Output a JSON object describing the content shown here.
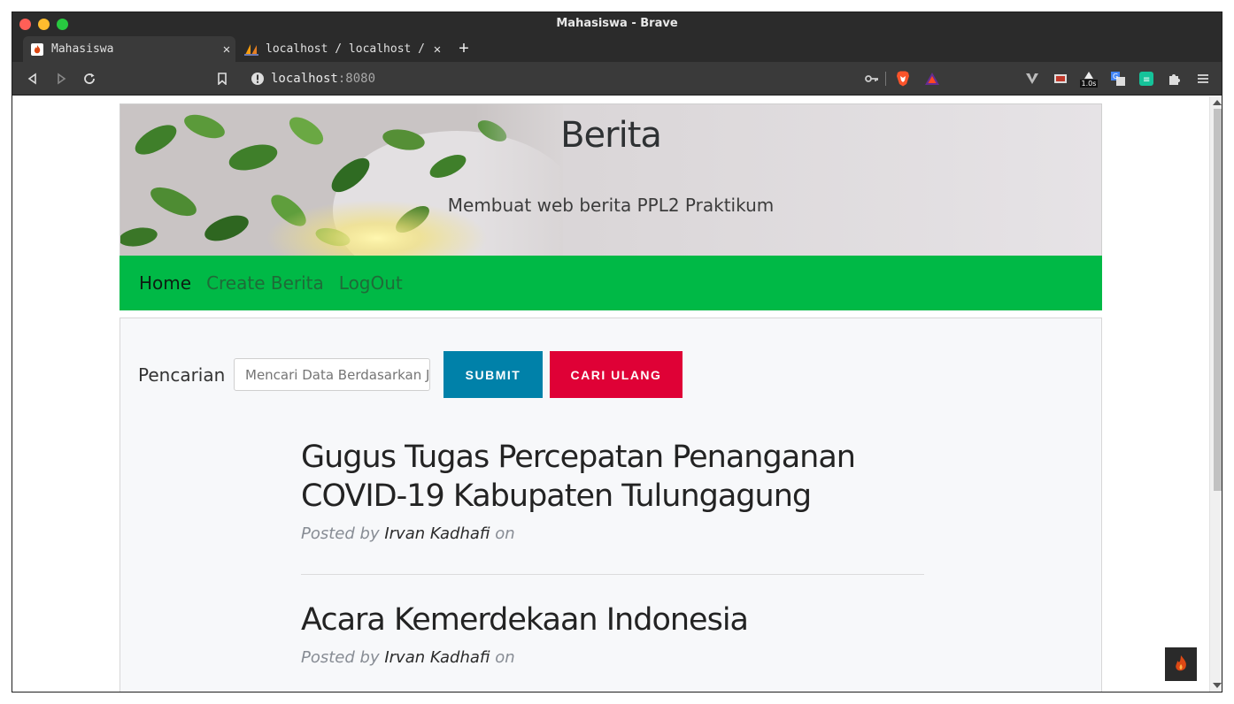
{
  "window": {
    "title": "Mahasiswa - Brave"
  },
  "tabs": [
    {
      "label": "Mahasiswa",
      "active": true,
      "icon": "codeigniter-flame-icon"
    },
    {
      "label": "localhost / localhost / ppl-ber",
      "active": false,
      "icon": "phpmyadmin-sail-icon"
    }
  ],
  "address_bar": {
    "host": "localhost",
    "port": ":8080"
  },
  "page": {
    "header": {
      "title": "Berita",
      "subtitle": "Membuat web berita PPL2 Praktikum"
    },
    "nav": [
      {
        "label": "Home",
        "active": true
      },
      {
        "label": "Create Berita",
        "active": false
      },
      {
        "label": "LogOut",
        "active": false
      }
    ],
    "search": {
      "label": "Pencarian",
      "placeholder": "Mencari Data Berdasarkan Judul",
      "submit_label": "SUBMIT",
      "reset_label": "CARI ULANG"
    },
    "posts": [
      {
        "title": "Gugus Tugas Percepatan Penanganan COVID-19 Kabupaten Tulungagung",
        "posted_by": "Posted by",
        "author": "Irvan Kadhafi",
        "on": "on"
      },
      {
        "title": "Acara Kemerdekaan Indonesia",
        "posted_by": "Posted by",
        "author": "Irvan Kadhafi",
        "on": "on"
      }
    ]
  },
  "colors": {
    "nav_green": "#00b946",
    "submit_blue": "#0081a9",
    "reset_red": "#df0136"
  },
  "extensions": [
    "vivaldi-icon",
    "screenshot-icon",
    "timer-extension-icon",
    "translate-icon",
    "grammar-icon",
    "puzzle-icon"
  ],
  "extension_badge": "1.0s"
}
